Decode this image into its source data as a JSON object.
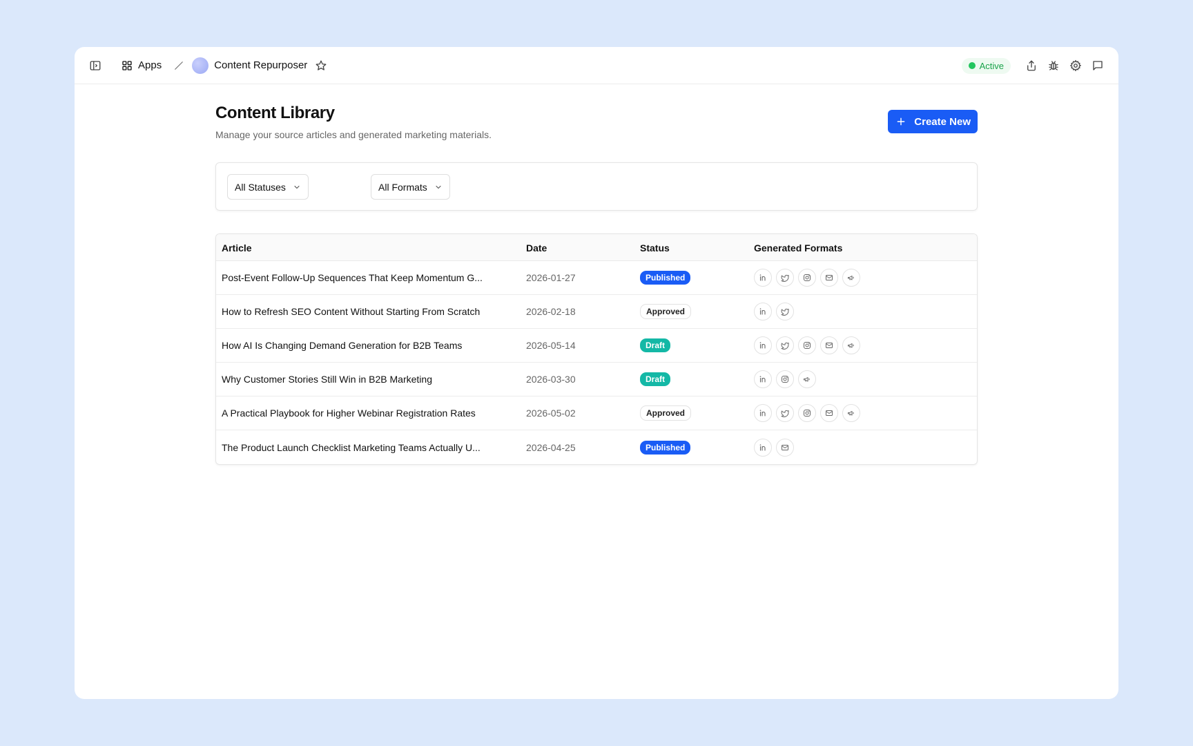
{
  "topbar": {
    "apps_label": "Apps",
    "app_name": "Content Repurposer",
    "status_label": "Active",
    "status_color": "#22c55e"
  },
  "header": {
    "title": "Content Library",
    "subtitle": "Manage your source articles and generated marketing materials.",
    "create_label": "Create New"
  },
  "filters": {
    "status_selected": "All Statuses",
    "format_selected": "All Formats"
  },
  "table": {
    "columns": [
      "Article",
      "Date",
      "Status",
      "Generated Formats"
    ],
    "rows": [
      {
        "article": "Post-Event Follow-Up Sequences That Keep Momentum G...",
        "date": "2026-01-27",
        "status": "Published",
        "formats": [
          "linkedin",
          "twitter",
          "instagram",
          "email",
          "ads"
        ]
      },
      {
        "article": "How to Refresh SEO Content Without Starting From Scratch",
        "date": "2026-02-18",
        "status": "Approved",
        "formats": [
          "linkedin",
          "twitter"
        ]
      },
      {
        "article": "How AI Is Changing Demand Generation for B2B Teams",
        "date": "2026-05-14",
        "status": "Draft",
        "formats": [
          "linkedin",
          "twitter",
          "instagram",
          "email",
          "ads"
        ]
      },
      {
        "article": "Why Customer Stories Still Win in B2B Marketing",
        "date": "2026-03-30",
        "status": "Draft",
        "formats": [
          "linkedin",
          "instagram",
          "ads"
        ]
      },
      {
        "article": "A Practical Playbook for Higher Webinar Registration Rates",
        "date": "2026-05-02",
        "status": "Approved",
        "formats": [
          "linkedin",
          "twitter",
          "instagram",
          "email",
          "ads"
        ]
      },
      {
        "article": "The Product Launch Checklist Marketing Teams Actually U...",
        "date": "2026-04-25",
        "status": "Published",
        "formats": [
          "linkedin",
          "email"
        ]
      }
    ]
  },
  "colors": {
    "accent": "#1a5cf5",
    "draft": "#14b8a6",
    "background": "#dbe8fb"
  }
}
